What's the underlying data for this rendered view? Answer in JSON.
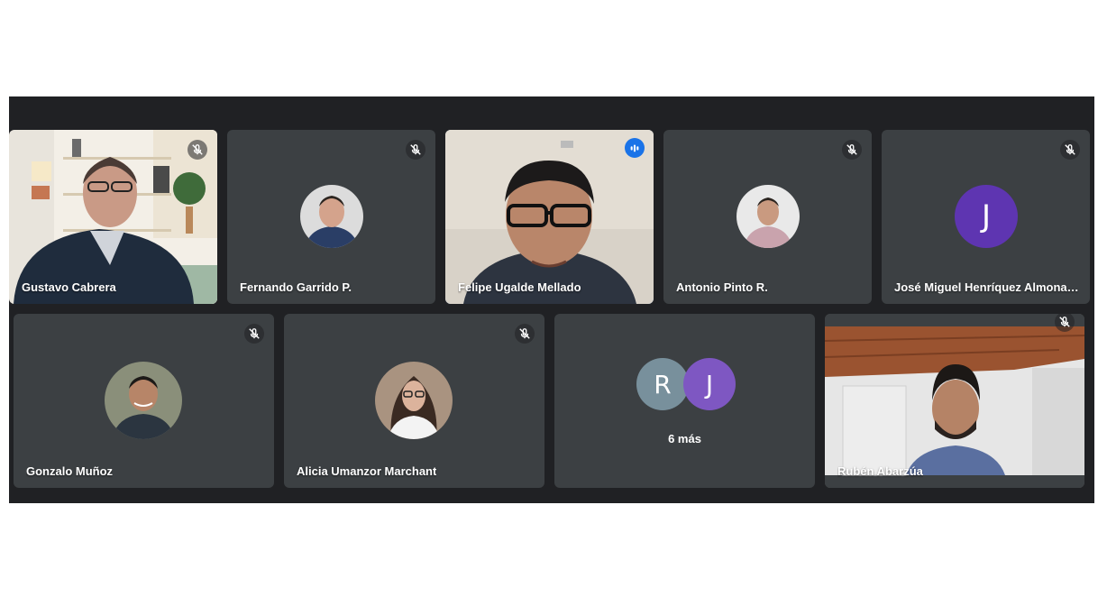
{
  "participants": [
    {
      "name": "Gustavo Cabrera",
      "muted": true,
      "video": true
    },
    {
      "name": "Fernando Garrido P.",
      "muted": true,
      "video": false
    },
    {
      "name": "Felipe Ugalde Mellado",
      "muted": false,
      "speaking": true,
      "video": true
    },
    {
      "name": "Antonio Pinto R.",
      "muted": true,
      "video": false
    },
    {
      "name": "José Miguel Henríquez Almonac...",
      "muted": true,
      "video": false,
      "initial": "J"
    },
    {
      "name": "Gonzalo Muñoz",
      "muted": true,
      "video": false
    },
    {
      "name": "Alicia Umanzor Marchant",
      "muted": true,
      "video": false
    },
    {
      "name": "Rubén Abarzúa",
      "muted": true,
      "video": true
    }
  ],
  "overflow": {
    "initials": [
      "R",
      "J"
    ],
    "label": "6 más"
  },
  "colors": {
    "background": "#202124",
    "tile": "#3c4043",
    "speaking": "#1a73e8",
    "avatar_purple": "#5e35b1",
    "avatar_slate": "#78909c",
    "avatar_violet": "#7e57c2"
  }
}
